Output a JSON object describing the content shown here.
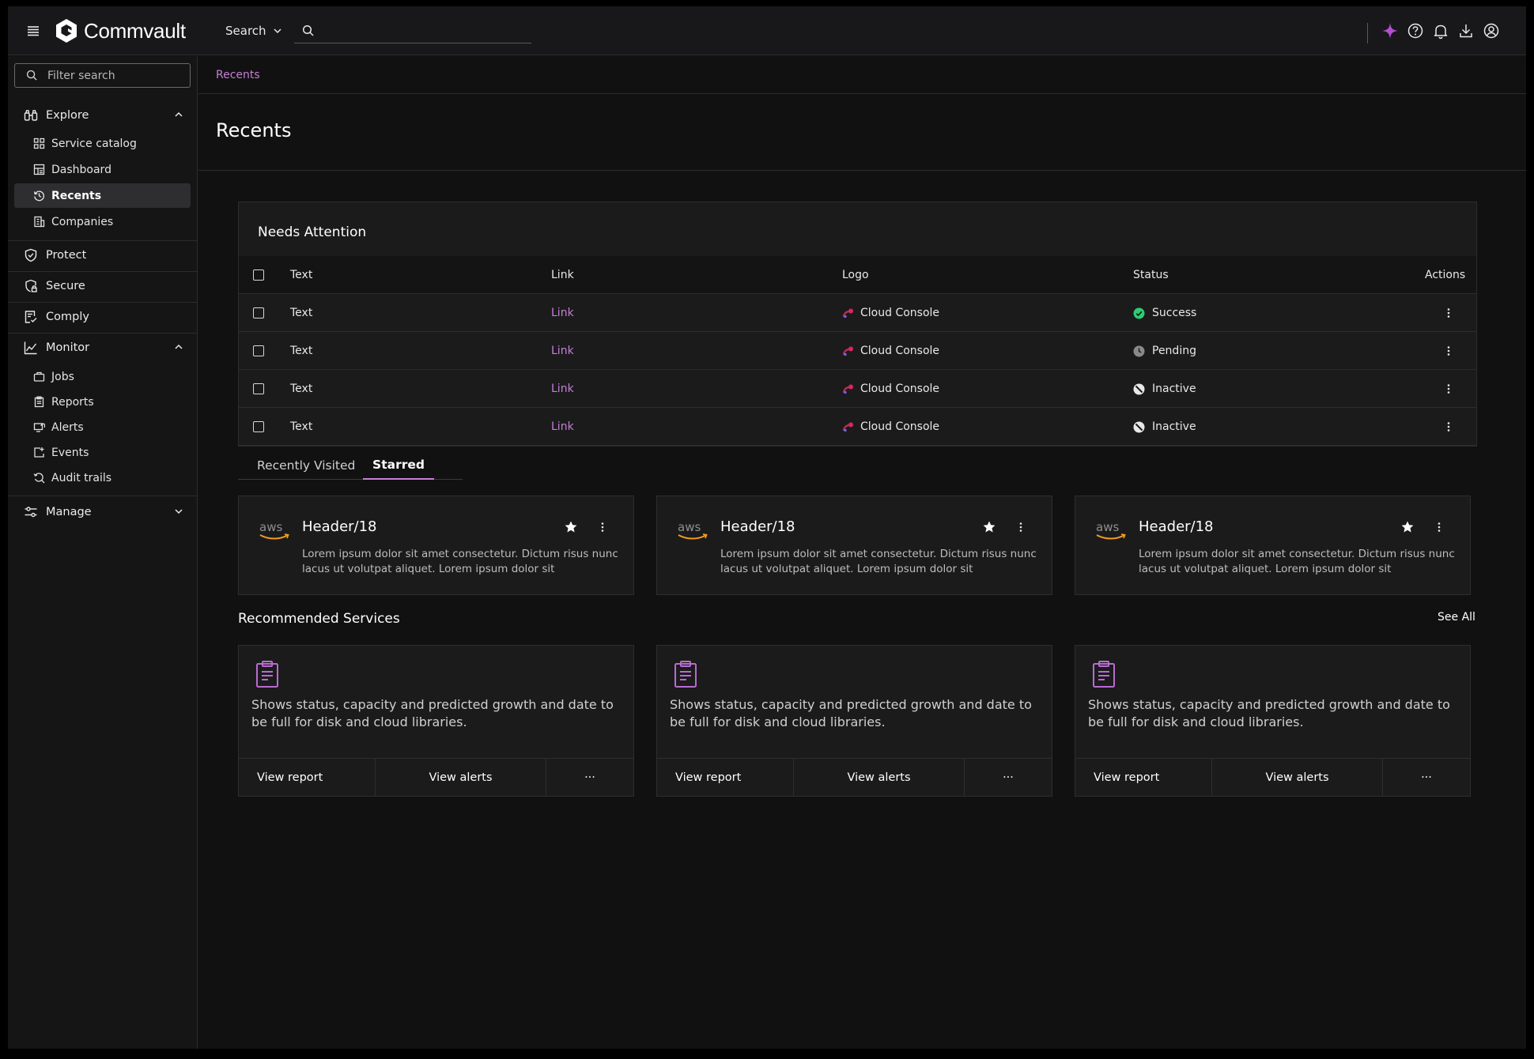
{
  "topbar": {
    "logo_text": "Commvault",
    "search_scope": "Search",
    "search_value": ""
  },
  "sidebar": {
    "filter_placeholder": "Filter search",
    "groups": [
      {
        "label": "Explore",
        "items": [
          "Service catalog",
          "Dashboard",
          "Recents",
          "Companies"
        ]
      },
      {
        "label": "Protect"
      },
      {
        "label": "Secure"
      },
      {
        "label": "Comply"
      },
      {
        "label": "Monitor",
        "items": [
          "Jobs",
          "Reports",
          "Alerts",
          "Events",
          "Audit trails"
        ]
      },
      {
        "label": "Manage"
      }
    ],
    "active_item": "Recents"
  },
  "breadcrumb": "Recents",
  "page_title": "Recents",
  "attention": {
    "title": "Needs Attention",
    "columns": [
      "Text",
      "Link",
      "Logo",
      "Status",
      "Actions"
    ],
    "rows": [
      {
        "text": "Text",
        "link": "Link",
        "logo": "Cloud Console",
        "status": "Success"
      },
      {
        "text": "Text",
        "link": "Link",
        "logo": "Cloud Console",
        "status": "Pending"
      },
      {
        "text": "Text",
        "link": "Link",
        "logo": "Cloud Console",
        "status": "Inactive"
      },
      {
        "text": "Text",
        "link": "Link",
        "logo": "Cloud Console",
        "status": "Inactive"
      }
    ]
  },
  "tabs": {
    "items": [
      "Recently Visited",
      "Starred"
    ],
    "active": "Starred"
  },
  "starred_cards": [
    {
      "logo_text": "aws",
      "title": "Header/18",
      "desc": "Lorem ipsum dolor sit amet consectetur. Dictum risus nunc lacus ut volutpat aliquet. Lorem ipsum dolor sit"
    },
    {
      "logo_text": "aws",
      "title": "Header/18",
      "desc": "Lorem ipsum dolor sit amet consectetur. Dictum risus nunc lacus ut volutpat aliquet. Lorem ipsum dolor sit"
    },
    {
      "logo_text": "aws",
      "title": "Header/18",
      "desc": "Lorem ipsum dolor sit amet consectetur. Dictum risus nunc lacus ut volutpat aliquet. Lorem ipsum dolor sit"
    }
  ],
  "recommended": {
    "title": "Recommended Services",
    "see_all": "See All",
    "cards": [
      {
        "desc": "Shows status, capacity and predicted growth and date to be full for disk and cloud libraries.",
        "btn1": "View report",
        "btn2": "View alerts",
        "more": "···"
      },
      {
        "desc": "Shows status, capacity and predicted growth and date to be full for disk and cloud libraries.",
        "btn1": "View report",
        "btn2": "View alerts",
        "more": "···"
      },
      {
        "desc": "Shows status, capacity and predicted growth and date to be full for disk and cloud libraries.",
        "btn1": "View report",
        "btn2": "View alerts",
        "more": "···"
      }
    ]
  },
  "colors": {
    "accent": "#c77fd6",
    "success": "#2ecc71",
    "background": "#111112"
  }
}
